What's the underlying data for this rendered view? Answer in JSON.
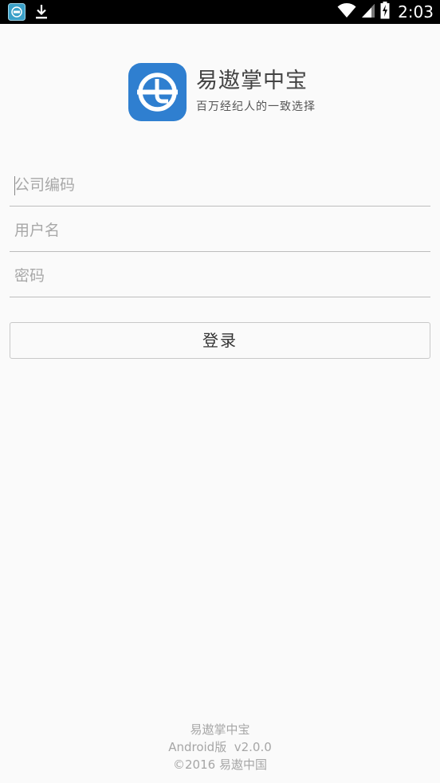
{
  "status_bar": {
    "time": "2:03",
    "icons": [
      "app-notification-icon",
      "download-icon",
      "wifi-icon",
      "signal-icon",
      "battery-charging-icon"
    ]
  },
  "header": {
    "app_name": "易遨掌中宝",
    "slogan": "百万经纪人的一致选择",
    "logo_color": "#2f7fd0"
  },
  "form": {
    "company_code_placeholder": "公司编码",
    "username_placeholder": "用户名",
    "password_placeholder": "密码",
    "login_label": "登录"
  },
  "footer": {
    "app_name": "易遨掌中宝",
    "version": "Android版  v2.0.0",
    "copyright": "©2016 易遨中国"
  }
}
